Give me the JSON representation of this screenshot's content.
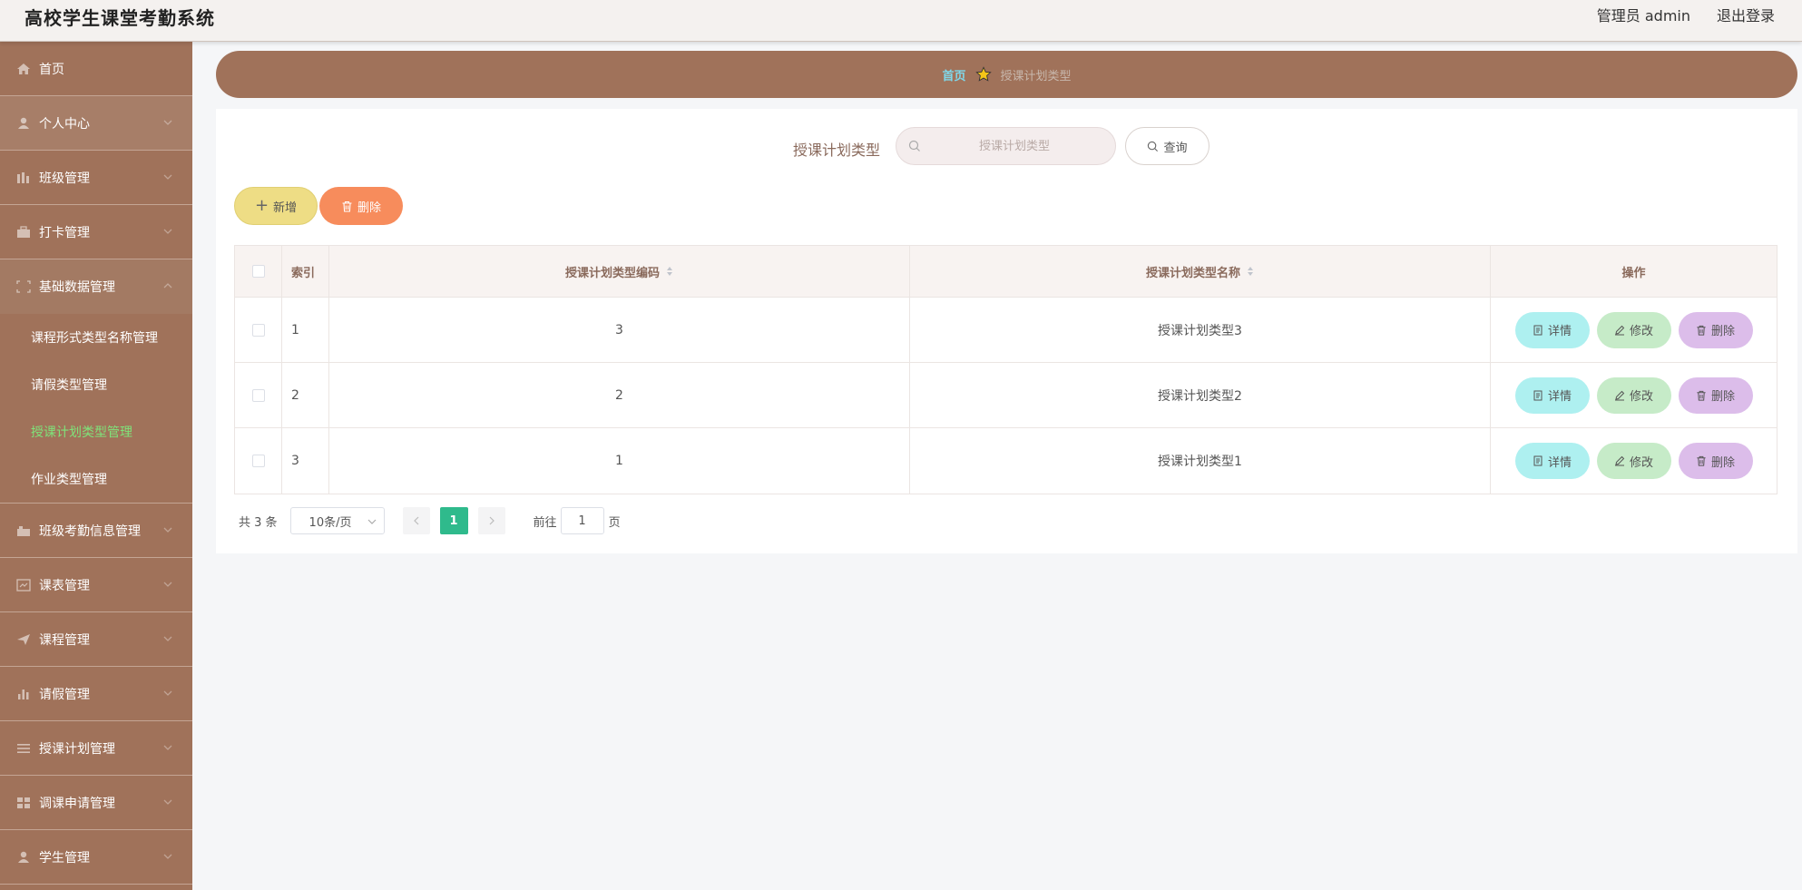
{
  "header": {
    "title": "高校学生课堂考勤系统",
    "user_label": "管理员 admin",
    "logout_label": "退出登录"
  },
  "sidebar": {
    "items": [
      {
        "label": "首页",
        "icon": "home-icon"
      },
      {
        "label": "个人中心",
        "icon": "user-icon"
      },
      {
        "label": "班级管理",
        "icon": "bar-icon"
      },
      {
        "label": "打卡管理",
        "icon": "briefcase-icon"
      },
      {
        "label": "基础数据管理",
        "icon": "frame-icon",
        "expanded": true,
        "children": [
          "课程形式类型名称管理",
          "请假类型管理",
          "授课计划类型管理",
          "作业类型管理"
        ],
        "active_child": "授课计划类型管理"
      },
      {
        "label": "班级考勤信息管理",
        "icon": "briefcase-icon"
      },
      {
        "label": "课表管理",
        "icon": "board-icon"
      },
      {
        "label": "课程管理",
        "icon": "send-icon"
      },
      {
        "label": "请假管理",
        "icon": "bar-icon"
      },
      {
        "label": "授课计划管理",
        "icon": "list-icon"
      },
      {
        "label": "调课申请管理",
        "icon": "grid-icon"
      },
      {
        "label": "学生管理",
        "icon": "user-icon"
      }
    ]
  },
  "breadcrumb": {
    "home": "首页",
    "current": "授课计划类型"
  },
  "search": {
    "label": "授课计划类型",
    "placeholder": "授课计划类型",
    "button": "查询"
  },
  "actions": {
    "add": "新增",
    "delete": "删除"
  },
  "table": {
    "columns": [
      "索引",
      "授课计划类型编码",
      "授课计划类型名称",
      "操作"
    ],
    "rows": [
      {
        "index": "1",
        "code": "3",
        "name": "授课计划类型3"
      },
      {
        "index": "2",
        "code": "2",
        "name": "授课计划类型2"
      },
      {
        "index": "3",
        "code": "1",
        "name": "授课计划类型1"
      }
    ],
    "row_actions": {
      "detail": "详情",
      "edit": "修改",
      "delete": "删除"
    }
  },
  "pagination": {
    "total": "共 3 条",
    "page_size": "10条/页",
    "current_page": "1",
    "goto_prefix": "前往",
    "goto_value": "1",
    "goto_suffix": "页"
  },
  "colors": {
    "sidebar_bg": "#a0725a",
    "active_submenu": "#7fe37a",
    "page_active": "#2fba8c",
    "add_button": "#eedd85",
    "delete_button": "#f78c5c"
  }
}
